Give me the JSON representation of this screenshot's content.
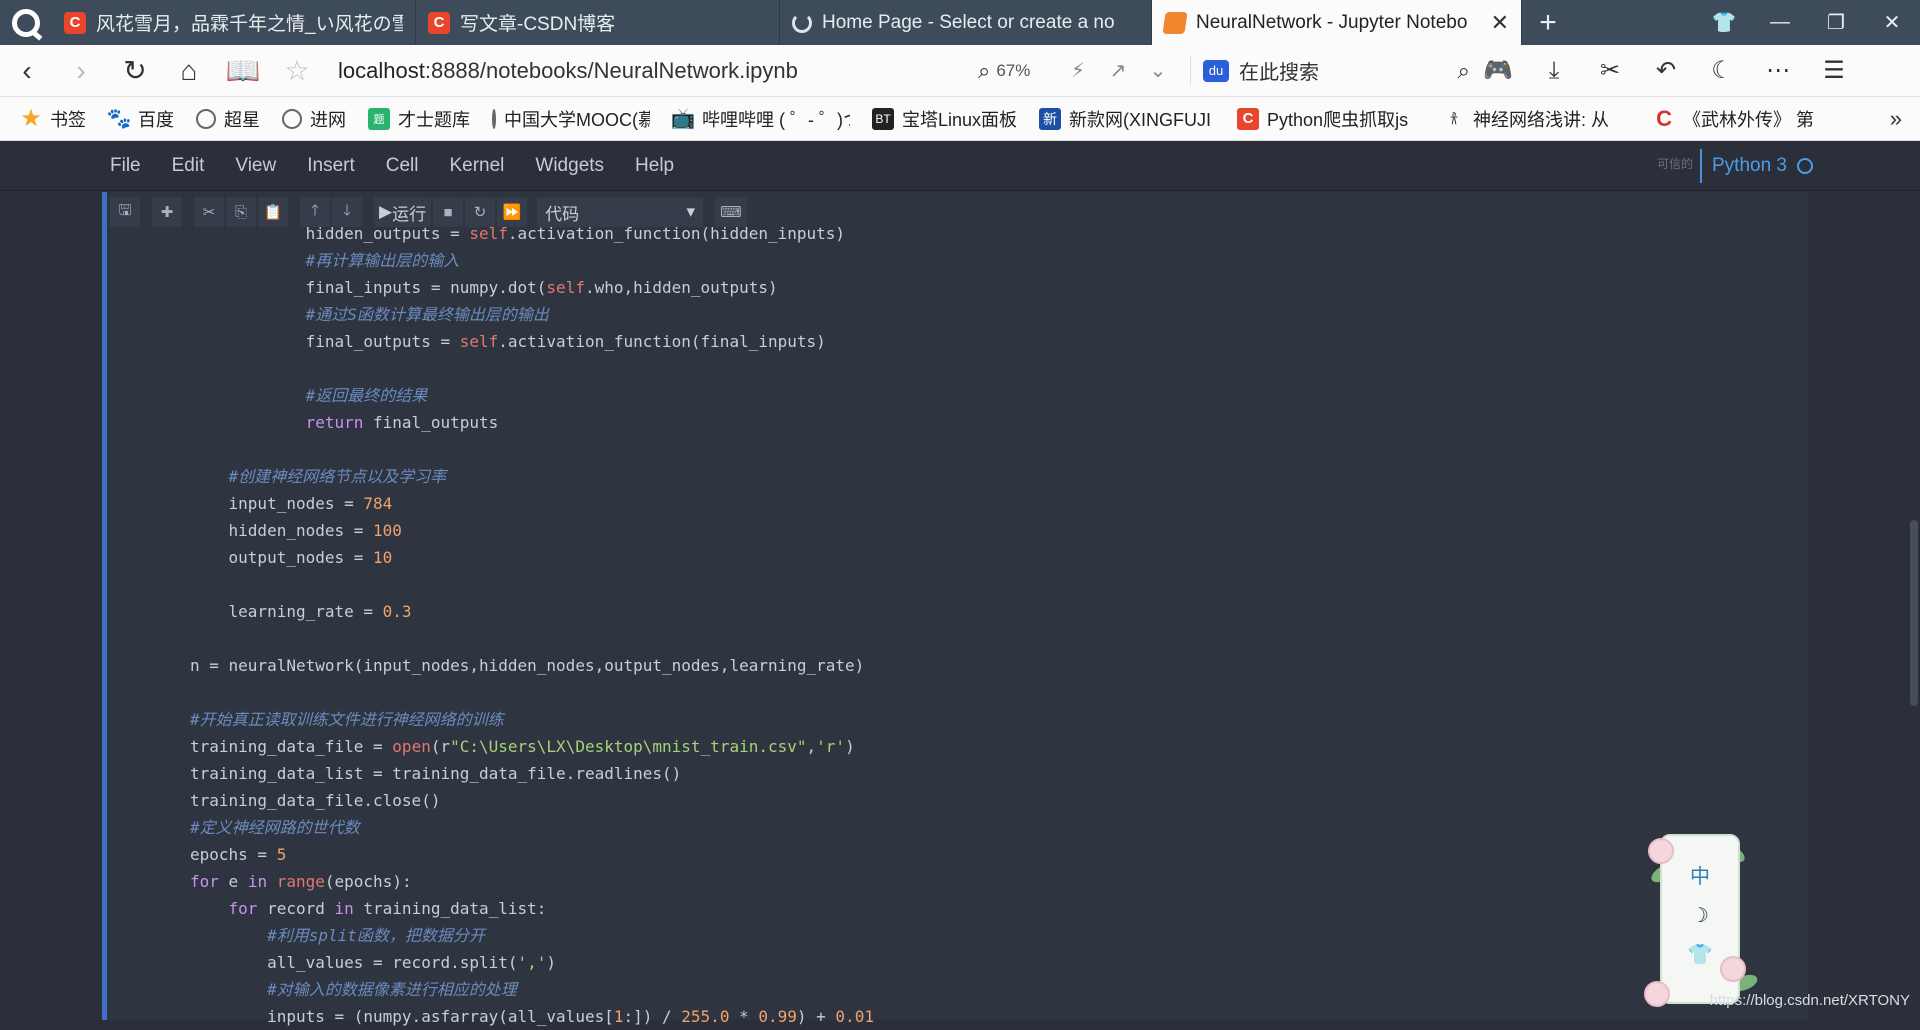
{
  "browser": {
    "tabs": [
      {
        "title": "风花雪月，品霖千年之情_い风花の雪",
        "active": false,
        "icon": "csdn-icon"
      },
      {
        "title": "写文章-CSDN博客",
        "active": false,
        "icon": "csdn-icon"
      },
      {
        "title": "Home Page - Select or create a no",
        "active": false,
        "icon": "loading-icon"
      },
      {
        "title": "NeuralNetwork - Jupyter Notebo",
        "active": true,
        "icon": "jupyter-icon"
      }
    ],
    "url_host": "localhost",
    "url_path": ":8888/notebooks/NeuralNetwork.ipynb",
    "zoom": "67%",
    "search_placeholder": "在此搜索"
  },
  "bookmarks": [
    {
      "label": "书签",
      "icon": "star-icon"
    },
    {
      "label": "百度",
      "icon": "paw-icon"
    },
    {
      "label": "超星",
      "icon": "globe-icon"
    },
    {
      "label": "进网",
      "icon": "globe-icon"
    },
    {
      "label": "才士题库",
      "icon": "book-icon"
    },
    {
      "label": "中国大学MOOC(慕",
      "icon": "globe-icon"
    },
    {
      "label": "哔哩哔哩 ( ゜- ゜)つ",
      "icon": "tv-icon"
    },
    {
      "label": "宝塔Linux面板",
      "icon": "bt-icon"
    },
    {
      "label": "新款网(XINGFUJI",
      "icon": "xin-icon"
    },
    {
      "label": "Python爬虫抓取js",
      "icon": "csdn-icon"
    },
    {
      "label": "神经网络浅讲: 从",
      "icon": "figure-icon"
    },
    {
      "label": "《武林外传》 第",
      "icon": "c-icon"
    }
  ],
  "jupyter": {
    "menu": [
      "File",
      "Edit",
      "View",
      "Insert",
      "Cell",
      "Kernel",
      "Widgets",
      "Help"
    ],
    "trusted": "可信的",
    "kernel": "Python 3",
    "toolbar": {
      "run_label": "运行",
      "cell_type": "代码"
    }
  },
  "code_lines": [
    [
      "    ",
      "",
      "hidden_outputs = ",
      "",
      "self",
      "slf",
      ".activation_function(hidden_inputs)",
      ""
    ],
    [
      "    ",
      "",
      "#再计算输出层的输入",
      "cm"
    ],
    [
      "    ",
      "",
      "final_inputs = numpy.dot(",
      "",
      "self",
      "slf",
      ".who,hidden_outputs)",
      ""
    ],
    [
      "    ",
      "",
      "#通过S函数计算最终输出层的输出",
      "cm"
    ],
    [
      "    ",
      "",
      "final_outputs = ",
      "",
      "self",
      "slf",
      ".activation_function(final_inputs)",
      ""
    ],
    [
      ""
    ],
    [
      "    ",
      "",
      "#返回最终的结果",
      "cm"
    ],
    [
      "    ",
      "",
      "return",
      "kw",
      " final_outputs",
      ""
    ],
    [
      ""
    ],
    [
      "",
      "",
      "#创建神经网络节点以及学习率",
      "cm"
    ],
    [
      "",
      "",
      "input_nodes = ",
      "",
      "784",
      "num"
    ],
    [
      "",
      "",
      "hidden_nodes = ",
      "",
      "100",
      "num"
    ],
    [
      "",
      "",
      "output_nodes = ",
      "",
      "10",
      "num"
    ],
    [
      ""
    ],
    [
      "",
      "",
      "learning_rate = ",
      "",
      "0.3",
      "num"
    ],
    [
      ""
    ],
    [
      "n = neuralNetwork(input_nodes,hidden_nodes,output_nodes,learning_rate)",
      "",
      "",
      ""
    ],
    [
      ""
    ],
    [
      "#开始真正读取训练文件进行神经网络的训练",
      "cm"
    ],
    [
      "training_data_file = ",
      "",
      "open",
      "bi",
      "(r",
      "",
      "\"C:\\Users\\LX\\Desktop\\mnist_train.csv\"",
      "str",
      ",",
      "",
      "'r'",
      "str",
      ")",
      ""
    ],
    [
      "training_data_list = training_data_file.readlines()",
      ""
    ],
    [
      "training_data_file.close()",
      ""
    ],
    [
      "#定义神经网路的世代数",
      "cm"
    ],
    [
      "epochs = ",
      "",
      "5",
      "num"
    ],
    [
      "for",
      "kw",
      " e ",
      "",
      "in",
      "kw",
      " ",
      "",
      "range",
      "bi",
      "(epochs):",
      ""
    ],
    [
      "    ",
      "",
      "for",
      "kw",
      " record ",
      "",
      "in",
      "kw",
      " training_data_list:",
      ""
    ],
    [
      "        ",
      "",
      "#利用split函数，把数据分开",
      "cm"
    ],
    [
      "        ",
      "",
      "all_values = record.split(",
      "",
      "','",
      "str",
      ")",
      ""
    ],
    [
      "        ",
      "",
      "#对输入的数据像素进行相应的处理",
      "cm"
    ],
    [
      "        ",
      "",
      "inputs = (numpy.asfarray(all_values[",
      "",
      "1",
      "num",
      ":]) / ",
      "",
      "255.0",
      "num",
      " * ",
      "",
      "0.99",
      "num",
      ") + ",
      "",
      "0.01",
      "num"
    ]
  ],
  "widget": {
    "line1": "中",
    "line2": "☽",
    "line3": "👕"
  },
  "watermark": "https://blog.csdn.net/XRTONY"
}
